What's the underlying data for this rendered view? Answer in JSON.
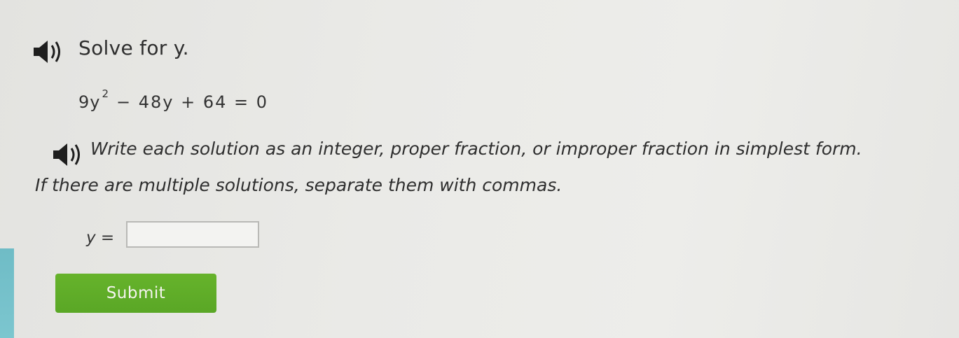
{
  "problem": {
    "title": "Solve for y.",
    "equation": {
      "base": "9y",
      "exponent": "2",
      "rest": "− 48y + 64 = 0"
    },
    "instruction_line1": "Write each solution as an integer, proper fraction, or improper fraction in simplest form.",
    "instruction_line2": "If there are multiple solutions, separate them with commas."
  },
  "answer": {
    "label": "y =",
    "value": ""
  },
  "submit": {
    "label": "Submit"
  },
  "icons": {
    "audio": "speaker-icon"
  },
  "colors": {
    "submit_green": "#5fae28",
    "accent_teal": "#74c1ca"
  }
}
